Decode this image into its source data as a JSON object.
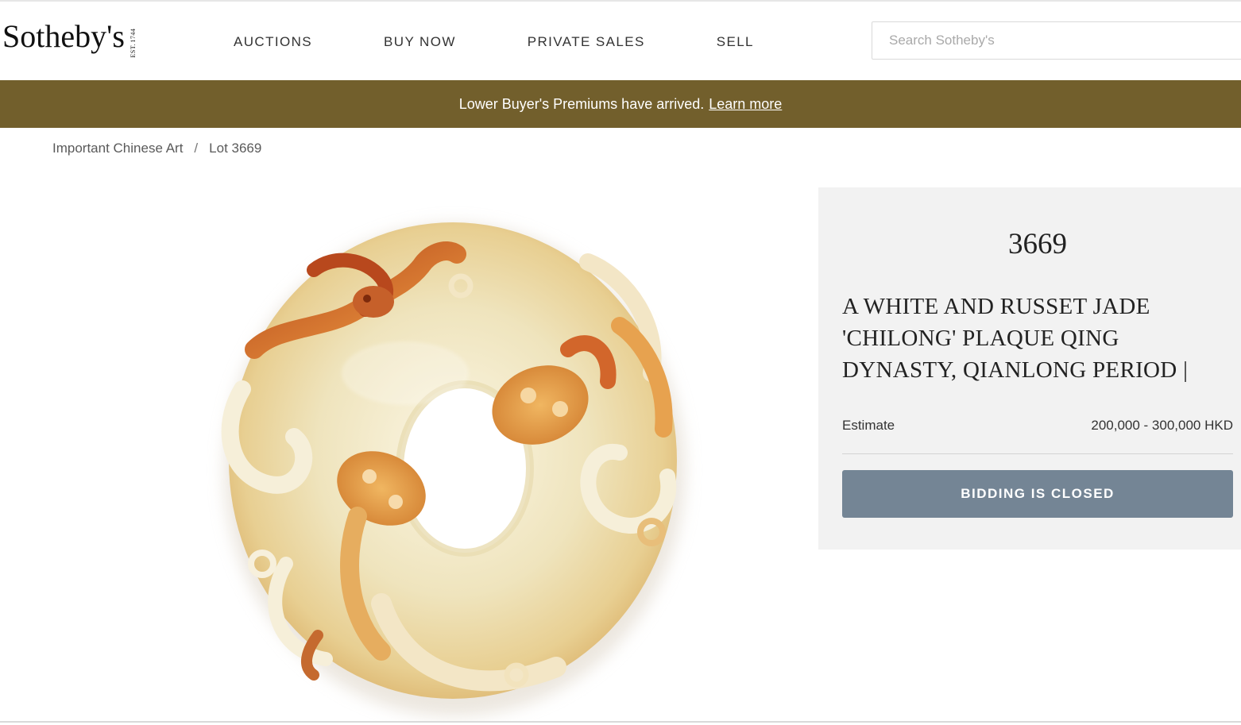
{
  "header": {
    "logo_text": "Sotheby's",
    "logo_est": "EST.",
    "logo_year": "1744",
    "nav": [
      {
        "label": "AUCTIONS"
      },
      {
        "label": "BUY NOW"
      },
      {
        "label": "PRIVATE SALES"
      },
      {
        "label": "SELL"
      }
    ],
    "search": {
      "placeholder": "Search Sotheby's",
      "value": ""
    }
  },
  "banner": {
    "text": "Lower Buyer's Premiums have arrived.",
    "link": "Learn more",
    "background": "#725f2c"
  },
  "breadcrumb": {
    "items": [
      "Important Chinese Art",
      "Lot 3669"
    ],
    "separator": "/"
  },
  "lot": {
    "image_icon": "jade-plaque-image",
    "number": "3669",
    "title": "A WHITE AND RUSSET JADE 'CHILONG' PLAQUE QING DYNASTY, QIANLONG PERIOD |",
    "estimate_label": "Estimate",
    "estimate_value": "200,000 - 300,000 HKD",
    "status_button": "BIDDING IS CLOSED",
    "button_color": "#748595"
  }
}
